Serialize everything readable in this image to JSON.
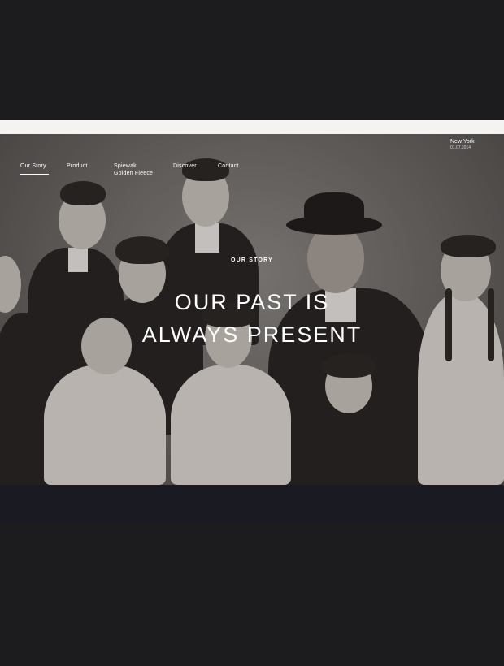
{
  "nav": {
    "items": [
      {
        "label": "Our Story",
        "active": true
      },
      {
        "label": "Product",
        "active": false
      },
      {
        "label": "Spiewak\nGolden Fleece",
        "active": false
      },
      {
        "label": "Discover",
        "active": false
      },
      {
        "label": "Contact",
        "active": false
      }
    ]
  },
  "location": {
    "city": "New York",
    "date": "01.07.2014"
  },
  "hero": {
    "eyebrow": "OUR STORY",
    "headline_line1": "OUR PAST IS",
    "headline_line2": "ALWAYS PRESENT",
    "image_alt": "vintage family portrait photograph"
  },
  "colors": {
    "frame": "#1c1c1e",
    "band": "#f4f3f1",
    "text": "#ffffff"
  }
}
